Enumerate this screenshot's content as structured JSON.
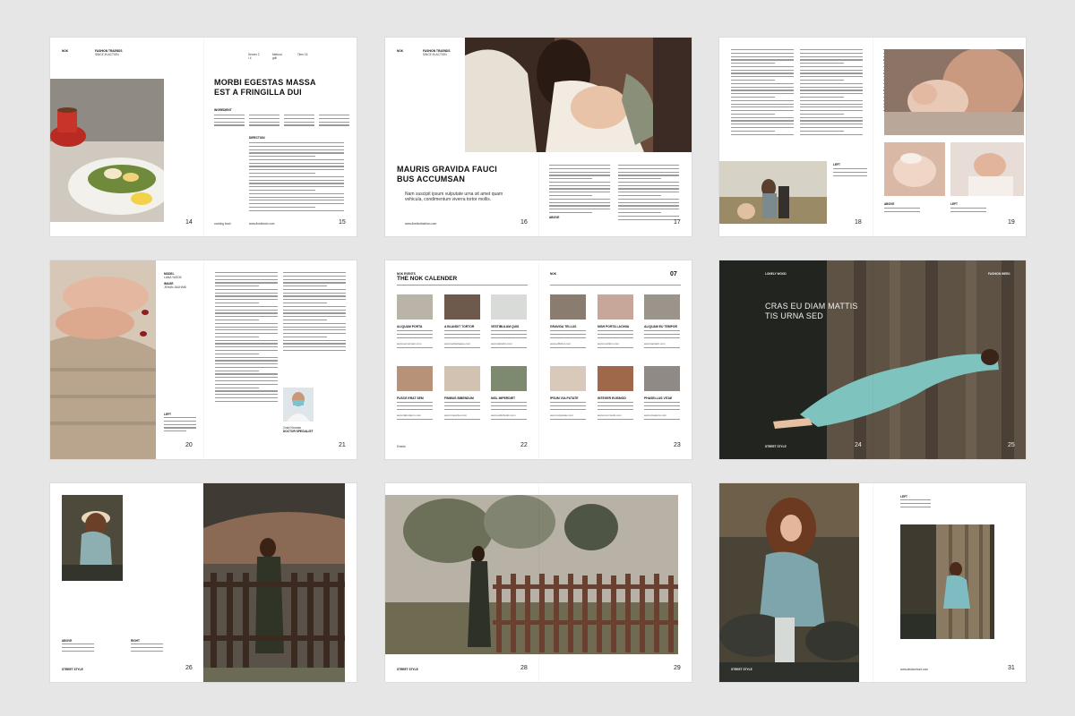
{
  "s1": {
    "brand": "NOK",
    "section": "FASHION TRAENDS",
    "section_sub": "SINCE IN ACTION",
    "meta1": "Serves 2 / 4",
    "meta2": "Method grill",
    "meta3": "Time 15",
    "title_l1": "MORBI EGESTAS MASSA",
    "title_l2": "EST A FRINGILLA DUI",
    "ingredient_label": "INGREDIENT",
    "direction_label": "DIRECTION",
    "foot_left": "cooking book",
    "foot_url": "www.fineldorsh.com",
    "page_left": "14",
    "page_right": "15"
  },
  "s2": {
    "brand": "NOK",
    "section": "FASHION TRAENDS",
    "section_sub": "SINCE IN ACTION",
    "title_l1": "MAURIS GRAVIDA FAUCI",
    "title_l2": "BUS ACCUMSAN",
    "sub_l1": "Nam suscipit ipsum vulputate urna sit amet quam",
    "sub_l2": "vehicula, condimentum viverra tortor mollis.",
    "foot_url": "www.fineldorfashion.com",
    "cap_label": "ABOVE",
    "page_left": "16",
    "page_right": "17"
  },
  "s3": {
    "cap_left": "LEFT",
    "cap_above": "ABOVE",
    "page_left": "18",
    "page_right": "19"
  },
  "s4": {
    "model_label": "MODEL",
    "model_name": "LANA YASOK",
    "image_label": "IMAGE",
    "image_name": "JEHAN JAUHANI",
    "cap_left": "LEFT",
    "doc_name": "Zoski Kinanan",
    "doc_role": "DOCTOR SPECIALIST",
    "page_left": "20",
    "page_right": "21"
  },
  "s5": {
    "eyebrow": "NOK EVENTS",
    "title": "THE NOK CALENDER",
    "brand_right": "NOK",
    "issue": "07",
    "items": [
      {
        "title": "ALIQUAM PORTA",
        "url": "www.accumsan.com"
      },
      {
        "title": "A BLANDIT TORTOR",
        "url": "www.seftanlaque.com"
      },
      {
        "title": "VESTIBULUM QUIS",
        "url": "www.tellusbs.com"
      },
      {
        "title": "GRAVIDA TELLUS",
        "url": "www.efficitur.com"
      },
      {
        "title": "NISH PORTA LACINIA",
        "url": "www.rectilum.com"
      },
      {
        "title": "ALIQUAM EU TEMPOR",
        "url": "www.landerit.com"
      },
      {
        "title": "FUSCE ERAT SEM",
        "url": "www.laboratum.com"
      },
      {
        "title": "FINIBUS BIBENDUM",
        "url": "www.impertiet.com"
      },
      {
        "title": "NISL IMPERDIET",
        "url": "www.sollicitudin.com"
      },
      {
        "title": "IPSUM VULPUTATE",
        "url": "www.vulputate.com"
      },
      {
        "title": "INTEGER EUISMOD",
        "url": "www.commodo.com"
      },
      {
        "title": "PHASELLUS VITAE",
        "url": "www.vitaeturs.com"
      }
    ],
    "foot_left": "Events",
    "page_left": "22",
    "page_right": "23"
  },
  "s6": {
    "brand": "LONELY WOOD",
    "section": "FASHION WEEK",
    "title_l1": "CRAS EU DIAM MATTIS",
    "title_l2": "TIS URNA SED",
    "foot_left": "STREET STYLE",
    "page_left": "24",
    "page_right": "25"
  },
  "s7": {
    "cap_above": "ABOVE",
    "cap_right": "RIGHT",
    "foot_left": "STREET STYLE",
    "page_right": "26"
  },
  "s8": {
    "foot_left": "STREET STYLE",
    "page_left": "28",
    "page_right": "29"
  },
  "s9": {
    "cap_left": "LEFT",
    "foot_left": "STREET STYLE",
    "foot_url": "www.fashionhunt.com",
    "page_right": "31"
  }
}
